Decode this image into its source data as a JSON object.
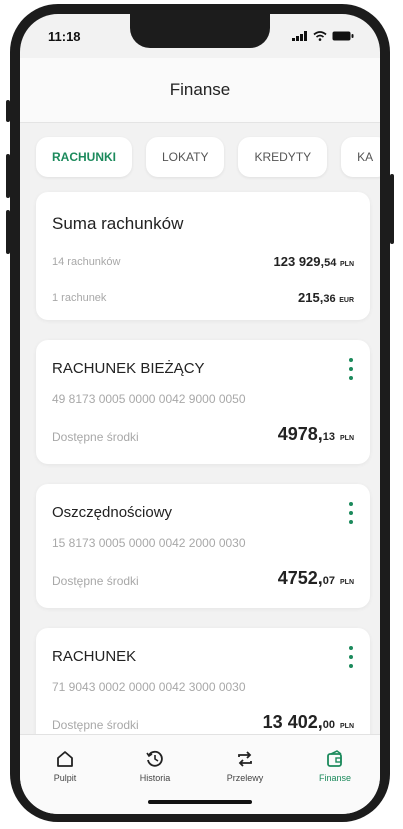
{
  "status": {
    "time": "11:18"
  },
  "header": {
    "title": "Finanse"
  },
  "tabs": [
    {
      "label": "RACHUNKI",
      "active": true
    },
    {
      "label": "LOKATY",
      "active": false
    },
    {
      "label": "KREDYTY",
      "active": false
    },
    {
      "label": "KA",
      "active": false
    }
  ],
  "summary": {
    "title": "Suma rachunków",
    "rows": [
      {
        "label": "14 rachunków",
        "amount_int": "123 929,",
        "amount_dec": "54",
        "currency": "PLN"
      },
      {
        "label": "1 rachunek",
        "amount_int": "215,",
        "amount_dec": "36",
        "currency": "EUR"
      }
    ]
  },
  "accounts": [
    {
      "name": "RACHUNEK BIEŻĄCY",
      "number": "49 8173 0005 0000 0042 9000 0050",
      "available_label": "Dostępne środki",
      "amount_int": "4978,",
      "amount_dec": "13",
      "currency": "PLN"
    },
    {
      "name": "Oszczędnościowy",
      "number": "15 8173 0005 0000 0042 2000 0030",
      "available_label": "Dostępne środki",
      "amount_int": "4752,",
      "amount_dec": "07",
      "currency": "PLN"
    },
    {
      "name": "RACHUNEK",
      "number": "71 9043 0002 0000 0042 3000 0030",
      "available_label": "Dostępne środki",
      "amount_int": "13 402,",
      "amount_dec": "00",
      "currency": "PLN"
    }
  ],
  "nav": [
    {
      "label": "Pulpit",
      "icon": "home-icon",
      "active": false
    },
    {
      "label": "Historia",
      "icon": "history-icon",
      "active": false
    },
    {
      "label": "Przelewy",
      "icon": "transfer-icon",
      "active": false
    },
    {
      "label": "Finanse",
      "icon": "finance-icon",
      "active": true
    }
  ],
  "colors": {
    "accent": "#1c8a5c"
  }
}
